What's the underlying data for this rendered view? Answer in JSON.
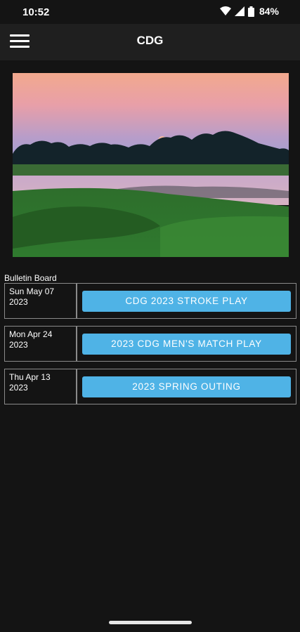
{
  "statusbar": {
    "time": "10:52",
    "battery": "84%",
    "icons": [
      "wifi-icon",
      "signal-icon",
      "battery-icon"
    ]
  },
  "appbar": {
    "title": "CDG",
    "menu_icon": "hamburger-menu-icon"
  },
  "hero_image": {
    "description_icon": "golf-course-sunset-image"
  },
  "bulletin": {
    "title": "Bulletin Board",
    "items": [
      {
        "date_line1": "Sun May 07",
        "date_line2": "2023",
        "label": "CDG 2023 STROKE PLAY"
      },
      {
        "date_line1": "Mon Apr 24",
        "date_line2": "2023",
        "label": "2023 CDG MEN'S MATCH PLAY"
      },
      {
        "date_line1": "Thu Apr 13",
        "date_line2": "2023",
        "label": "2023 SPRING OUTING"
      }
    ]
  },
  "colors": {
    "background": "#141414",
    "appbar": "#1f1f1f",
    "button": "#4fb3e6",
    "border": "#8a8a8a"
  }
}
